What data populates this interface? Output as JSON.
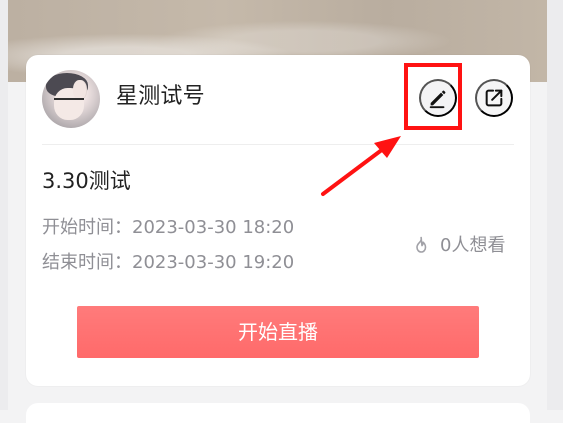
{
  "profile": {
    "username": "星测试号",
    "avatar": "avatar"
  },
  "actions": {
    "edit_icon": "pencil-icon",
    "share_icon": "share-icon"
  },
  "event": {
    "title": "3.30测试",
    "start_time_label": "开始时间：2023-03-30 18:20",
    "end_time_label": "结束时间：2023-03-30 19:20",
    "viewers_label": "0人想看",
    "start_button_label": "开始直播"
  },
  "annotation": {
    "color": "#ff1212"
  }
}
